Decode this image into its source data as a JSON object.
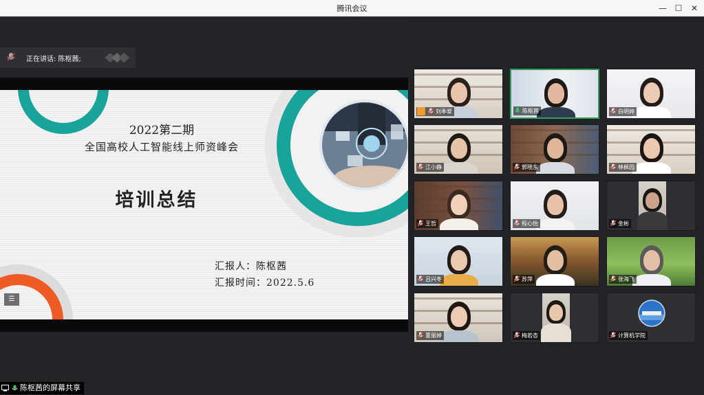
{
  "window": {
    "title": "腾讯会议",
    "controls": {
      "minimize": "—",
      "maximize": "☐",
      "close": "✕"
    }
  },
  "speaking": {
    "label": "正在讲话: 陈枢茜;"
  },
  "slide": {
    "title_line1": "2022第二期",
    "title_line2": "全国高校人工智能线上师资峰会",
    "main_title": "培训总结",
    "reporter": "汇报人：陈枢茜",
    "report_time": "汇报时间：2022.5.6",
    "accent_color": "#1aa39a",
    "orange_color": "#ef5b25"
  },
  "screen_share": {
    "label": "陈枢茜的屏幕共享"
  },
  "side_button": {
    "label": "☰"
  },
  "participants": [
    {
      "name": "刘季翠",
      "muted": true,
      "has_avatar_badge": true
    },
    {
      "name": "陈枢茜",
      "muted": false,
      "active": true
    },
    {
      "name": "白明婷",
      "muted": true
    },
    {
      "name": "江小静",
      "muted": true
    },
    {
      "name": "郭晓东",
      "muted": true
    },
    {
      "name": "林枫园",
      "muted": true
    },
    {
      "name": "王哲",
      "muted": true
    },
    {
      "name": "程心怡",
      "muted": true
    },
    {
      "name": "金彬",
      "muted": true
    },
    {
      "name": "吕兴冬",
      "muted": true
    },
    {
      "name": "苏萍",
      "muted": true
    },
    {
      "name": "张海飞",
      "muted": true
    },
    {
      "name": "董丽婷",
      "muted": true
    },
    {
      "name": "梅若杏",
      "muted": true
    },
    {
      "name": "计算机学院",
      "muted": true
    }
  ]
}
